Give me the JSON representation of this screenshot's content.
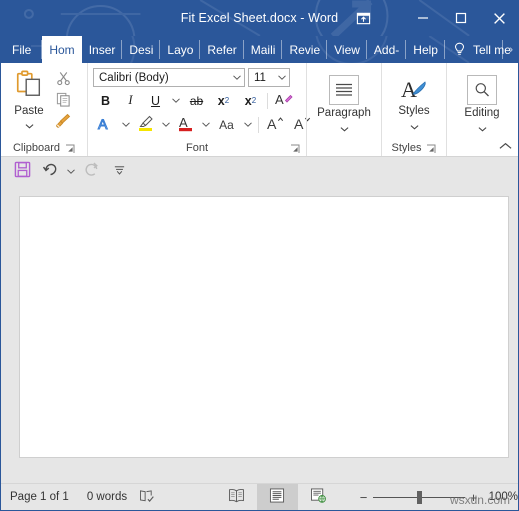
{
  "window": {
    "title": "Fit Excel Sheet.docx  -  Word",
    "ribbon_display_options_icon": "ribbon-display-options-icon",
    "minimize_icon": "minimize-icon",
    "maximize_icon": "maximize-icon",
    "close_icon": "close-icon",
    "accent_color": "#2b579a"
  },
  "tabs": {
    "items": [
      {
        "label": "File",
        "active": false
      },
      {
        "label": "Hom",
        "active": true
      },
      {
        "label": "Inser",
        "active": false
      },
      {
        "label": "Desi",
        "active": false
      },
      {
        "label": "Layo",
        "active": false
      },
      {
        "label": "Refer",
        "active": false
      },
      {
        "label": "Maili",
        "active": false
      },
      {
        "label": "Revie",
        "active": false
      },
      {
        "label": "View",
        "active": false
      },
      {
        "label": "Add-",
        "active": false
      },
      {
        "label": "Help",
        "active": false
      }
    ],
    "tell_me": "Tell me",
    "tell_me_icon": "lightbulb-icon",
    "overflow_label": "›"
  },
  "ribbon": {
    "clipboard": {
      "group_label": "Clipboard",
      "paste_label": "Paste",
      "paste_icon": "paste-clipboard-icon",
      "cut_icon": "scissors-icon",
      "copy_icon": "copy-icon",
      "format_painter_icon": "format-painter-icon",
      "dialog_launcher_icon": "dialog-launcher-icon"
    },
    "font": {
      "group_label": "Font",
      "font_name": "Calibri (Body)",
      "font_size": "11",
      "bold_label": "B",
      "italic_label": "I",
      "underline_label": "U",
      "strikethrough_label": "ab",
      "subscript_label": "x",
      "subscript_sub": "2",
      "superscript_label": "x",
      "superscript_sup": "2",
      "clear_formatting_icon": "clear-formatting-icon",
      "text_effects_label": "A",
      "highlight_icon": "text-highlight-icon",
      "font_color_label": "A",
      "change_case_label": "Aa",
      "grow_font_label": "A",
      "shrink_font_label": "A",
      "dialog_launcher_icon": "dialog-launcher-icon"
    },
    "paragraph": {
      "label": "Paragraph",
      "icon": "paragraph-lines-icon"
    },
    "styles": {
      "group_label": "Styles",
      "label": "Styles",
      "icon": "styles-brush-icon",
      "dialog_launcher_icon": "dialog-launcher-icon"
    },
    "editing": {
      "label": "Editing",
      "icon": "magnifier-icon"
    },
    "collapse_icon": "chevron-up-icon"
  },
  "quick_access": {
    "save_icon": "save-floppy-icon",
    "save_color": "#b05fd0",
    "undo_icon": "undo-arrow-icon",
    "redo_icon": "redo-arrow-icon",
    "customize_icon": "customize-toolbar-icon"
  },
  "status_bar": {
    "page_info": "Page 1 of 1",
    "word_count": "0 words",
    "proofing_icon": "proofing-errors-icon",
    "read_mode_icon": "read-mode-icon",
    "print_layout_icon": "print-layout-icon",
    "web_layout_icon": "web-layout-icon",
    "zoom_out_label": "−",
    "zoom_in_label": "+",
    "zoom_percent": "100%",
    "watermark": "wsxdn.com"
  }
}
